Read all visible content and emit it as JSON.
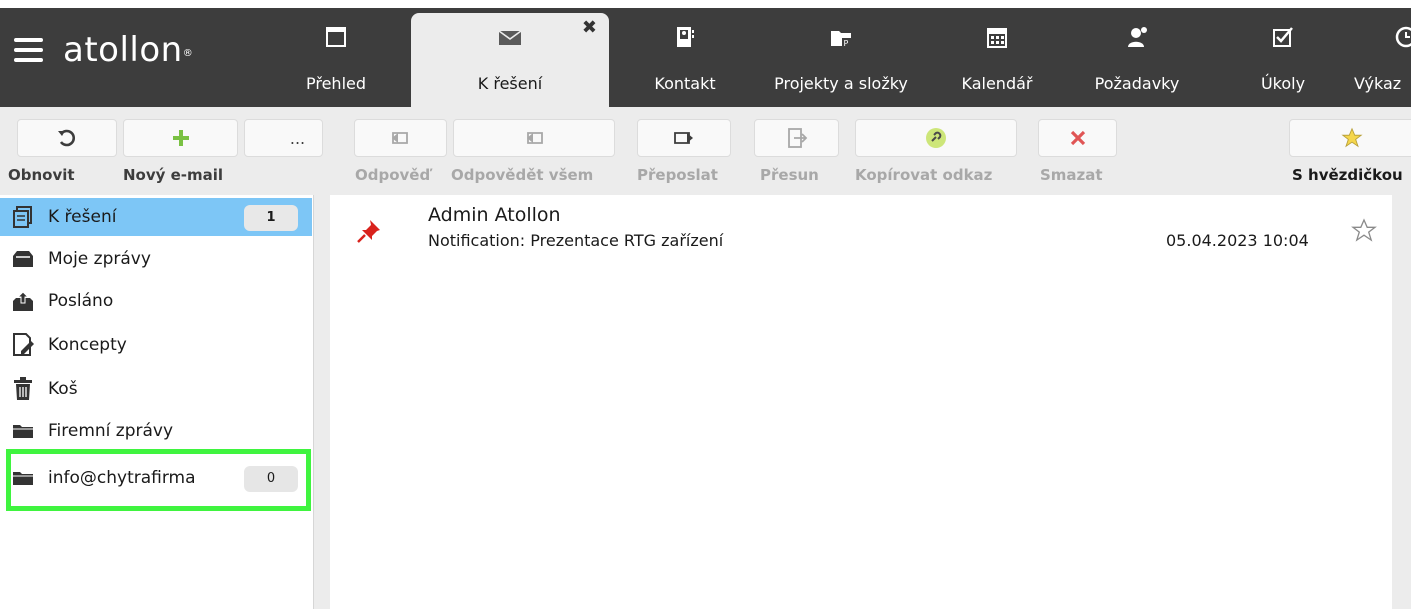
{
  "app": {
    "logo_text": "atollon",
    "logo_mark": "®"
  },
  "nav": {
    "tabs": [
      {
        "label": "Přehled",
        "icon": "window-icon"
      },
      {
        "label": "K řešení",
        "icon": "mail-icon",
        "active": true,
        "close_glyph": "✖"
      },
      {
        "label": "Kontakt",
        "icon": "contact-book-icon"
      },
      {
        "label": "Projekty a složky",
        "icon": "project-folder-icon"
      },
      {
        "label": "Kalendář",
        "icon": "calendar-icon"
      },
      {
        "label": "Požadavky",
        "icon": "user-request-icon"
      },
      {
        "label": "Úkoly",
        "icon": "checkbox-icon"
      },
      {
        "label": "Výkaz",
        "icon": "clock-icon"
      }
    ]
  },
  "toolbar": {
    "refresh_label": "Obnovit",
    "new_email_label": "Nový e-mail",
    "more_glyph": "...",
    "reply_label": "Odpověď",
    "reply_all_label": "Odpovědět všem",
    "forward_label": "Přeposlat",
    "move_label": "Přesun",
    "copy_link_label": "Kopírovat odkaz",
    "delete_label": "Smazat",
    "starred_label": "S hvězdičkou"
  },
  "sidebar": {
    "folders": [
      {
        "name": "K řešení",
        "count": "1",
        "icon": "inbox-tray-icon"
      },
      {
        "name": "Moje zprávy",
        "icon": "mailbox-icon"
      },
      {
        "name": "Posláno",
        "icon": "outbox-icon"
      },
      {
        "name": "Koncepty",
        "icon": "draft-icon"
      },
      {
        "name": "Koš",
        "icon": "trash-icon"
      },
      {
        "name": "Firemní zprávy",
        "icon": "folder-icon"
      },
      {
        "name": "info@chytrafirma",
        "count": "0",
        "icon": "folder-icon"
      }
    ]
  },
  "messages": [
    {
      "sender": "Admin  Atollon",
      "subject": "Notification: Prezentace RTG zařízení",
      "date": "05.04.2023 10:04",
      "pinned": true,
      "starred": false
    }
  ],
  "colors": {
    "nav_bg": "#3d3d3d",
    "toolbar_bg": "#ececec",
    "active_folder": "#7dc6f6",
    "highlight": "#3ff43f",
    "add_green": "#7ac143",
    "delete_red": "#e05555",
    "pin_red": "#d9221c",
    "star_yellow": "#f5d64c"
  }
}
